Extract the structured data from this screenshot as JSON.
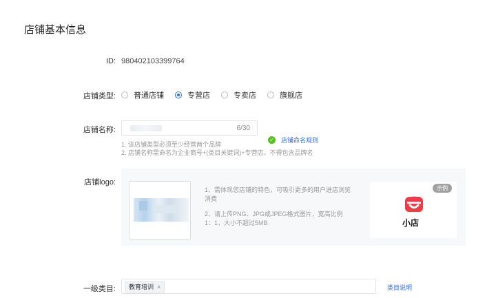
{
  "section_title": "店铺基本信息",
  "id_row": {
    "label": "ID:",
    "value": "980402103399764"
  },
  "shop_type": {
    "label": "店铺类型:",
    "options": [
      "普通店铺",
      "专营店",
      "专卖店",
      "旗舰店"
    ],
    "selected": "专营店"
  },
  "shop_name": {
    "label": "店铺名称:",
    "counter": "6/30",
    "hints": [
      "1. 该店铺类型必须至少经营两个品牌",
      "2. 店铺名称需命名为企业商号+(类目关键词)+专营店，不得包含品牌名"
    ],
    "rule_link": "店铺命名规则"
  },
  "shop_logo": {
    "label": "店铺logo:",
    "desc1": "1、需体现您店铺的特色，可吸引更多的用户进店浏览消费",
    "desc2": "2、请上传PNG、JPG或JPEG格式图片，宽高比例1：1，大小不超过5MB",
    "example_badge": "示例",
    "example_name": "小店"
  },
  "category": {
    "label": "一级类目:",
    "tag": "教育培训",
    "tag_close": "×",
    "help_link": "类目说明"
  }
}
